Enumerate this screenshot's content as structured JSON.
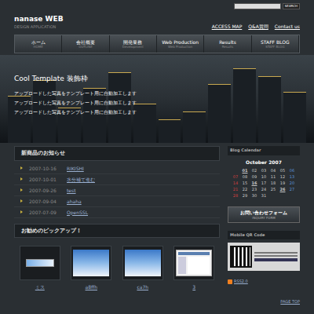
{
  "site": {
    "title": "nanase WEB",
    "subtitle": "DESIGN APPLICATION"
  },
  "search": {
    "placeholder": "",
    "button": "SEARCH"
  },
  "top_links": [
    "ACCESS MAP",
    "Q&A質問",
    "Contact us"
  ],
  "nav": [
    {
      "label": "ホーム",
      "sub": "HOME",
      "selected": false
    },
    {
      "label": "会社概要",
      "sub": "OUTLINE",
      "selected": false
    },
    {
      "label": "開発業務",
      "sub": "Development",
      "selected": false
    },
    {
      "label": "Web Production",
      "sub": "Web Production",
      "selected": false
    },
    {
      "label": "Results",
      "sub": "Results",
      "selected": false
    },
    {
      "label": "STAFF BLOG",
      "sub": "STAFF BLOG",
      "selected": false
    }
  ],
  "hero": {
    "title": "Cool Template 装飾枠",
    "lines": [
      "アップロードした写真をテンプレート用に自動加工します",
      "アップロードした写真をテンプレート用に自動加工します",
      "アップロードした写真をテンプレート用に自動加工します"
    ]
  },
  "news": {
    "title": "新商品のお知らせ",
    "items": [
      {
        "date": "2007-10-16",
        "title": "RIKISHI"
      },
      {
        "date": "2007-10-01",
        "title": "水分補て進む"
      },
      {
        "date": "2007-09-26",
        "title": "test"
      },
      {
        "date": "2007-09-04",
        "title": "ahaha"
      },
      {
        "date": "2007-07-09",
        "title": "OpenSSL"
      }
    ]
  },
  "pickup": {
    "title": "お勧めのピックアップ！",
    "items": [
      {
        "caption": "ミス",
        "kind": "banner"
      },
      {
        "caption": "a8ffh",
        "kind": "sky"
      },
      {
        "caption": "ca7h",
        "kind": "sky"
      },
      {
        "caption": "3",
        "kind": "screen"
      }
    ]
  },
  "calendar": {
    "title": "Blog Calendar",
    "month": "October 2007",
    "weeks": [
      [
        {
          "text": "",
          "color": "#d04040",
          "linked": false
        },
        {
          "text": "01",
          "color": "#c8c8c8",
          "linked": true
        },
        {
          "text": "02",
          "color": "#c8c8c8",
          "linked": false
        },
        {
          "text": "03",
          "color": "#c8c8c8",
          "linked": false
        },
        {
          "text": "04",
          "color": "#c8c8c8",
          "linked": false
        },
        {
          "text": "05",
          "color": "#c8c8c8",
          "linked": false
        },
        {
          "text": "06",
          "color": "#5a8fd8",
          "linked": false
        }
      ],
      [
        {
          "text": "07",
          "color": "#d04040",
          "linked": false
        },
        {
          "text": "08",
          "color": "#c8c8c8",
          "linked": false
        },
        {
          "text": "09",
          "color": "#c8c8c8",
          "linked": false
        },
        {
          "text": "10",
          "color": "#c8c8c8",
          "linked": false
        },
        {
          "text": "11",
          "color": "#c8c8c8",
          "linked": false
        },
        {
          "text": "12",
          "color": "#c8c8c8",
          "linked": false
        },
        {
          "text": "13",
          "color": "#5a8fd8",
          "linked": false
        }
      ],
      [
        {
          "text": "14",
          "color": "#d04040",
          "linked": false
        },
        {
          "text": "15",
          "color": "#c8c8c8",
          "linked": false
        },
        {
          "text": "16",
          "color": "#c8c8c8",
          "linked": true
        },
        {
          "text": "17",
          "color": "#c8c8c8",
          "linked": false
        },
        {
          "text": "18",
          "color": "#c8c8c8",
          "linked": false
        },
        {
          "text": "19",
          "color": "#c8c8c8",
          "linked": false
        },
        {
          "text": "20",
          "color": "#5a8fd8",
          "linked": false
        }
      ],
      [
        {
          "text": "21",
          "color": "#d04040",
          "linked": false
        },
        {
          "text": "22",
          "color": "#c8c8c8",
          "linked": false
        },
        {
          "text": "23",
          "color": "#c8c8c8",
          "linked": false
        },
        {
          "text": "24",
          "color": "#c8c8c8",
          "linked": false
        },
        {
          "text": "25",
          "color": "#c8c8c8",
          "linked": false
        },
        {
          "text": "26",
          "color": "#c8c8c8",
          "linked": true
        },
        {
          "text": "27",
          "color": "#5a8fd8",
          "linked": false
        }
      ],
      [
        {
          "text": "28",
          "color": "#d04040",
          "linked": false
        },
        {
          "text": "29",
          "color": "#c8c8c8",
          "linked": false
        },
        {
          "text": "30",
          "color": "#c8c8c8",
          "linked": false
        },
        {
          "text": "31",
          "color": "#c8c8c8",
          "linked": false
        },
        {
          "text": "",
          "color": "#c8c8c8",
          "linked": false
        },
        {
          "text": "",
          "color": "#c8c8c8",
          "linked": false
        },
        {
          "text": "",
          "color": "#5a8fd8",
          "linked": false
        }
      ]
    ]
  },
  "inquiry": {
    "title": "お問い合わせフォーム",
    "sub": "INQUIRY FORM"
  },
  "qr": {
    "title": "Mobile QR Code"
  },
  "rss": {
    "label": "RSS2.0"
  },
  "page_top": "PAGE TOP"
}
